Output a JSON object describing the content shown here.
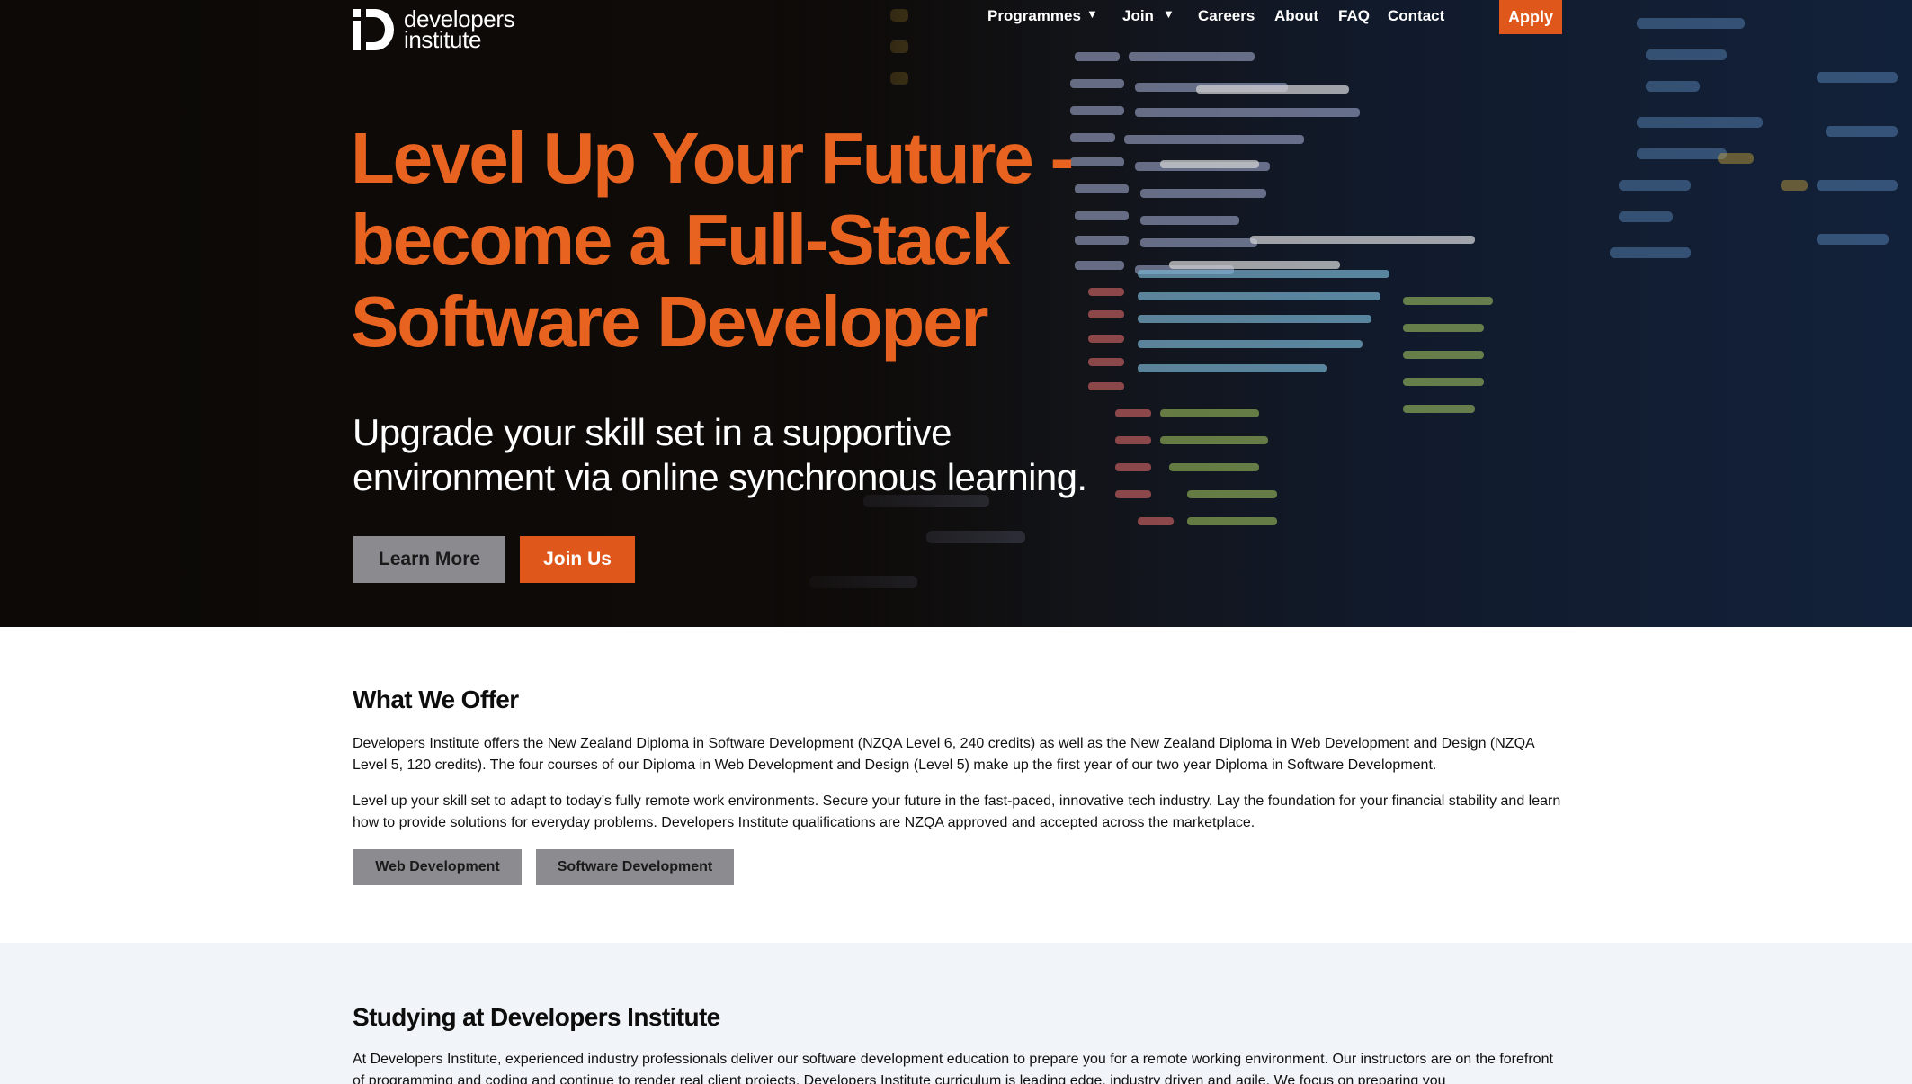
{
  "brand": {
    "line1": "developers",
    "line2": "institute"
  },
  "nav": {
    "items": [
      {
        "label": "Programmes",
        "caret": "▼"
      },
      {
        "label": "Join",
        "caret": "▼"
      },
      {
        "label": "Careers"
      },
      {
        "label": "About"
      },
      {
        "label": "FAQ"
      },
      {
        "label": "Contact"
      }
    ],
    "apply_label": "Apply"
  },
  "hero": {
    "title": "Level Up Your Future - become a Full-Stack Software Developer",
    "subtitle": "Upgrade your skill set in a supportive environment via online synchronous learning.",
    "learn_more_label": "Learn More",
    "join_us_label": "Join Us"
  },
  "offer": {
    "title": "What We Offer",
    "paragraph1": "Developers Institute offers the New Zealand Diploma in Software Development (NZQA Level 6, 240 credits) as well as the New Zealand Diploma in Web Development and Design (NZQA Level 5, 120 credits). The four courses of our Diploma in Web Development and Design (Level 5) make up the first year of our two year Diploma in Software Development.",
    "paragraph2": "Level up your skill set to adapt to today’s fully remote work environments. Secure your future in the fast-paced, innovative tech industry. Lay the foundation for your financial stability and learn how to provide solutions for everyday problems. Developers Institute qualifications are NZQA approved and accepted across the marketplace.",
    "web_dev_label": "Web Development",
    "software_dev_label": "Software Development"
  },
  "studying": {
    "title": "Studying at Developers Institute",
    "paragraph1": "At Developers Institute, experienced industry professionals deliver our software development education to prepare you for a remote working environment. Our instructors are on the forefront of programming and coding and continue to render real client projects. Developers Institute curriculum is leading edge, industry driven and agile. We focus on preparing you"
  },
  "colors": {
    "accent": "#e0571c",
    "hero_title": "#e8631f",
    "button_grey": "#8a8a8f",
    "section_alt_bg": "#f1f4f8"
  }
}
